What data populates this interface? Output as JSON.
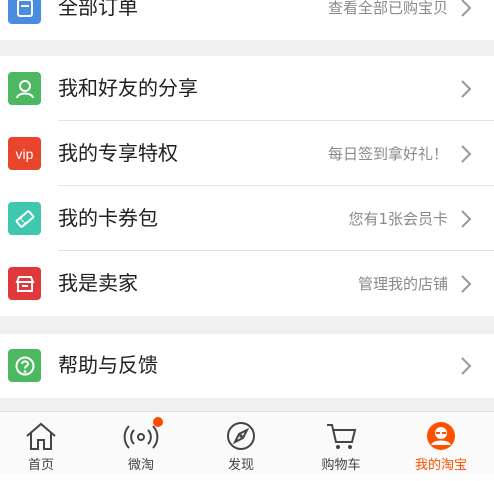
{
  "rows": [
    {
      "label": "全部订单",
      "hint": "查看全部已购宝贝",
      "icon": "order-list-icon",
      "color": "#4a8de0"
    },
    {
      "label": "我和好友的分享",
      "hint": "",
      "icon": "friend-share-icon",
      "color": "#4cb860"
    },
    {
      "label": "我的专享特权",
      "hint": "每日签到拿好礼！",
      "icon": "vip-icon",
      "icon_text": "vip",
      "color": "#e8452c"
    },
    {
      "label": "我的卡券包",
      "hint": "您有1张会员卡",
      "icon": "coupon-icon",
      "color": "#3fc7b0"
    },
    {
      "label": "我是卖家",
      "hint": "管理我的店铺",
      "icon": "store-icon",
      "color": "#e0393b"
    },
    {
      "label": "帮助与反馈",
      "hint": "",
      "icon": "help-icon",
      "color": "#4cb860"
    }
  ],
  "tabs": [
    {
      "label": "首页",
      "icon": "home-icon"
    },
    {
      "label": "微淘",
      "icon": "broadcast-icon",
      "badge": true
    },
    {
      "label": "发现",
      "icon": "discover-icon"
    },
    {
      "label": "购物车",
      "icon": "cart-icon"
    },
    {
      "label": "我的淘宝",
      "icon": "my-taobao-icon",
      "active": true
    }
  ],
  "accent_color": "#ff5000"
}
